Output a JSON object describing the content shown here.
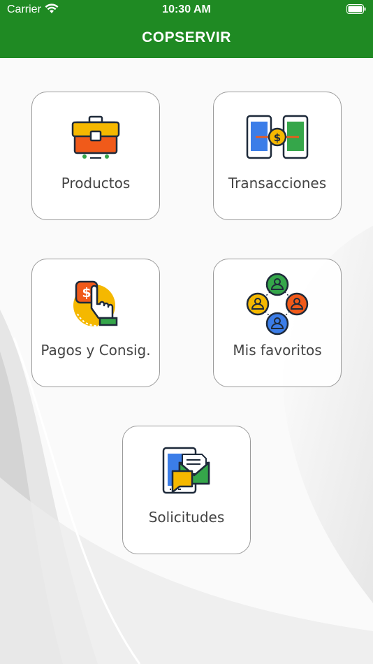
{
  "status_bar": {
    "carrier": "Carrier",
    "time": "10:30 AM"
  },
  "header": {
    "title": "COPSERVIR"
  },
  "menu": [
    {
      "label": "Productos",
      "icon": "briefcase-icon"
    },
    {
      "label": "Transacciones",
      "icon": "phone-transfer-icon"
    },
    {
      "label": "Pagos y Consig.",
      "icon": "payment-hand-icon"
    },
    {
      "label": "Mis favoritos",
      "icon": "contacts-network-icon"
    },
    {
      "label": "Solicitudes",
      "icon": "tablet-mail-icon"
    }
  ],
  "colors": {
    "header_green": "#1f8a23",
    "tile_border": "#9a9a9a",
    "label_text": "#444444",
    "icon_yellow": "#f5b800",
    "icon_orange": "#f05a1a",
    "icon_green": "#35a64a",
    "icon_blue": "#3b7de8",
    "icon_outline": "#1e2a3a"
  }
}
